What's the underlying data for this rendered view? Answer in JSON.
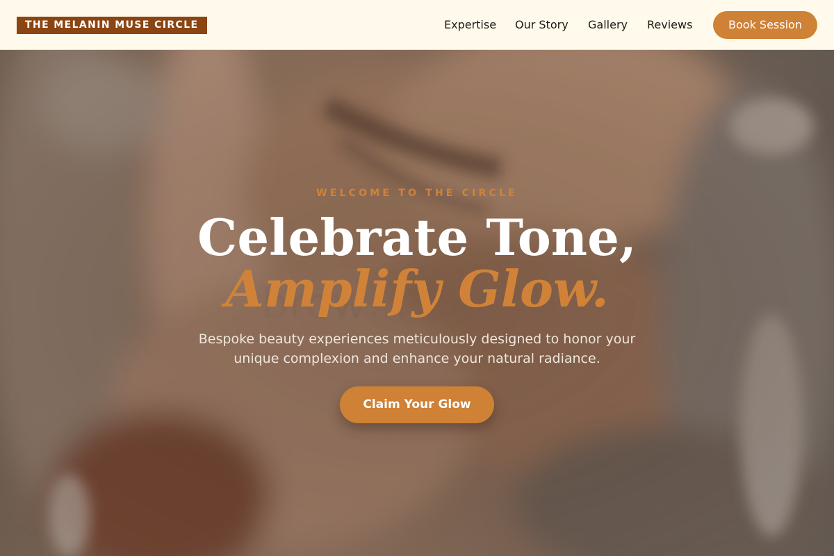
{
  "header": {
    "brand": "THE MELANIN MUSE CIRCLE",
    "nav": [
      {
        "label": "Expertise"
      },
      {
        "label": "Our Story"
      },
      {
        "label": "Gallery"
      },
      {
        "label": "Reviews"
      }
    ],
    "cta_label": "Book Session"
  },
  "hero": {
    "eyebrow": "WELCOME TO THE CIRCLE",
    "headline_line1": "Celebrate Tone,",
    "headline_line2": "Amplify Glow.",
    "background_text": "brow… beauty",
    "subtext": "Bespoke beauty experiences meticulously designed to honor your unique complexion and enhance your natural radiance.",
    "cta_label": "Claim Your Glow"
  },
  "colors": {
    "accent": "#cf8136",
    "brand_bg": "#8b4513",
    "header_bg": "#fffaec",
    "heading_text": "#ffffff"
  }
}
